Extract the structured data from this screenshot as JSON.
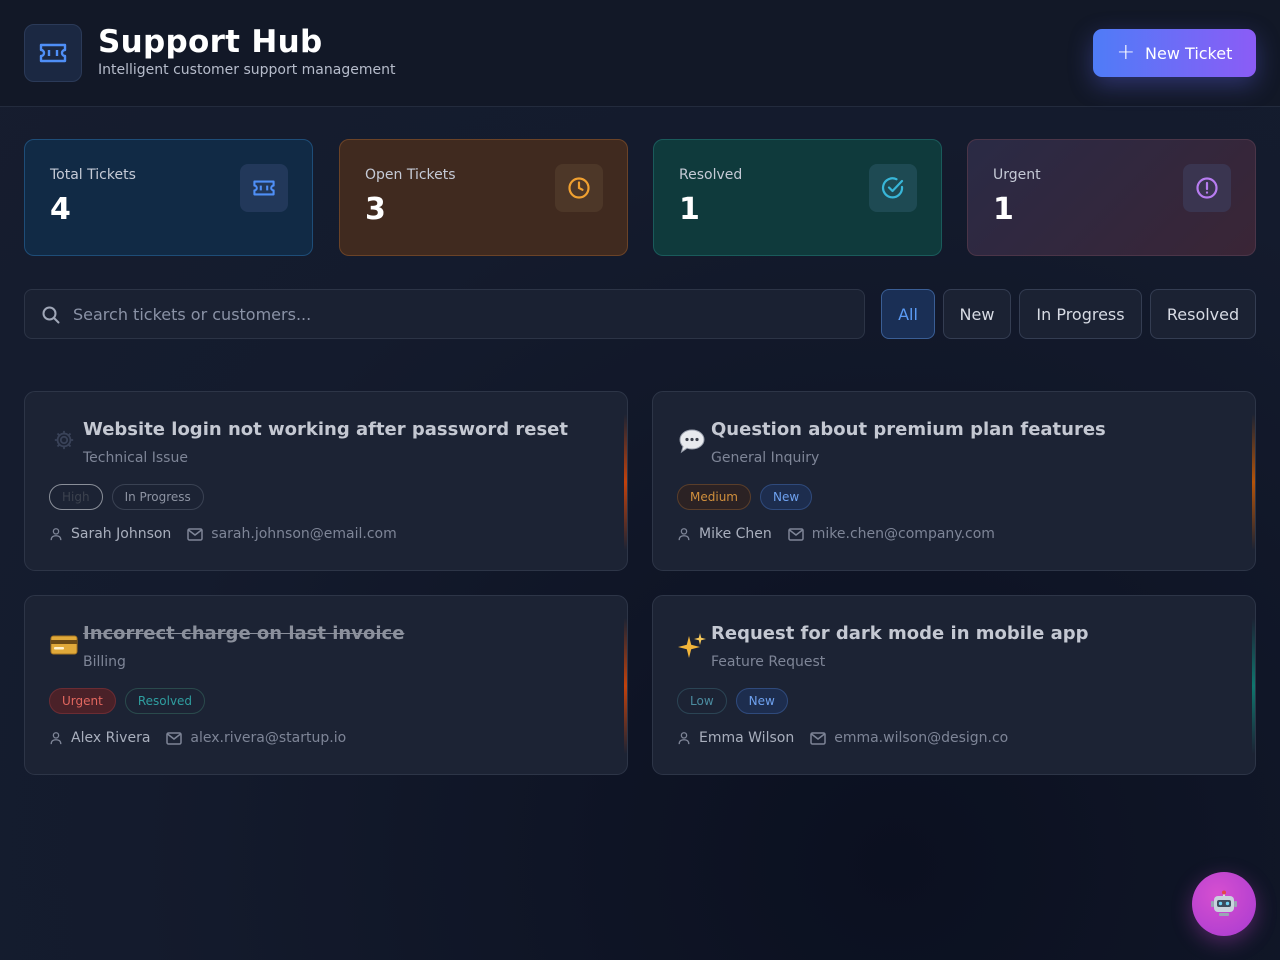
{
  "header": {
    "title": "Support Hub",
    "subtitle": "Intelligent customer support management",
    "new_ticket_label": "New Ticket",
    "logo_icon": "ticket-icon"
  },
  "stats": [
    {
      "label": "Total Tickets",
      "value": "4",
      "icon": "ticket-icon",
      "color": "#4f8ff7"
    },
    {
      "label": "Open Tickets",
      "value": "3",
      "icon": "clock-icon",
      "color": "#f0a030"
    },
    {
      "label": "Resolved",
      "value": "1",
      "icon": "check-circle-icon",
      "color": "#38b6d8"
    },
    {
      "label": "Urgent",
      "value": "1",
      "icon": "alert-circle-icon",
      "color": "#b77cf0"
    }
  ],
  "search": {
    "placeholder": "Search tickets or customers...",
    "value": ""
  },
  "filters": [
    {
      "label": "All",
      "active": true
    },
    {
      "label": "New",
      "active": false
    },
    {
      "label": "In Progress",
      "active": false
    },
    {
      "label": "Resolved",
      "active": false
    }
  ],
  "tickets": [
    {
      "icon": "gear-icon",
      "title": "Website login not working after password reset",
      "category": "Technical Issue",
      "priority": "High",
      "status": "In Progress",
      "customer": "Sarah Johnson",
      "email": "sarah.johnson@email.com",
      "accent_color": "#c2410c"
    },
    {
      "icon": "speech-bubble-icon",
      "title": "Question about premium plan features",
      "category": "General Inquiry",
      "priority": "Medium",
      "status": "New",
      "customer": "Mike Chen",
      "email": "mike.chen@company.com",
      "accent_color": "#b45309"
    },
    {
      "icon": "credit-card-icon",
      "title": "Incorrect charge on last invoice",
      "category": "Billing",
      "priority": "Urgent",
      "status": "Resolved",
      "customer": "Alex Rivera",
      "email": "alex.rivera@startup.io",
      "accent_color": "#c2410c"
    },
    {
      "icon": "sparkles-icon",
      "title": "Request for dark mode in mobile app",
      "category": "Feature Request",
      "priority": "Low",
      "status": "New",
      "customer": "Emma Wilson",
      "email": "emma.wilson@design.co",
      "accent_color": "#0f766e"
    }
  ],
  "assistant": {
    "icon": "robot-icon"
  }
}
